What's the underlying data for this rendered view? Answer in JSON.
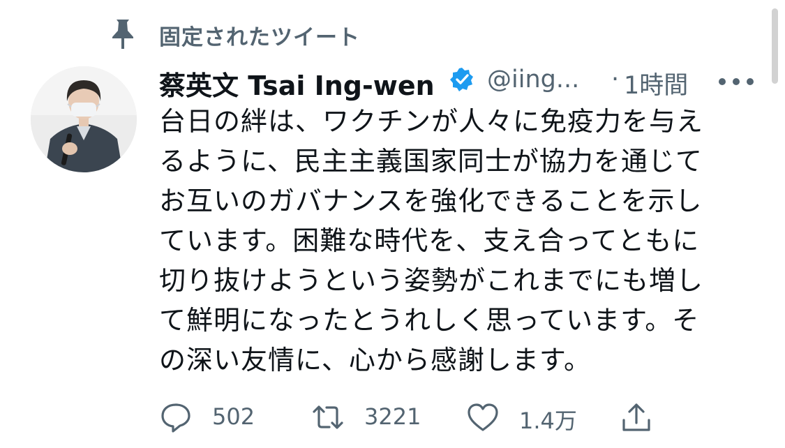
{
  "pinned": {
    "label": "固定されたツイート",
    "icon": "pin-icon"
  },
  "tweet": {
    "display_name": "蔡英文 Tsai Ing-wen",
    "handle": "@iing...",
    "separator": "·",
    "time": "1時間",
    "verified_icon": "verified-badge-icon",
    "avatar_icon": "avatar-photo",
    "text_lines": [
      "台日の絆は、ワクチンが人々に免疫力を与え",
      "るように、民主主義国家同士が協力を通じて",
      "お互いのガバナンスを強化できることを示し",
      "ています。困難な時代を、支え合ってともに",
      "切り抜けようという姿勢がこれまでにも増し",
      "て鮮明になったとうれしく思っています。そ",
      "の深い友情に、心から感謝します。"
    ]
  },
  "actions": {
    "reply": {
      "icon": "reply-icon",
      "count": "502"
    },
    "retweet": {
      "icon": "retweet-icon",
      "count": "3221"
    },
    "like": {
      "icon": "heart-icon",
      "count": "1.4万"
    },
    "share": {
      "icon": "share-icon"
    }
  },
  "colors": {
    "text": "#0f1419",
    "secondary": "#536471",
    "verified": "#1d9bf0"
  }
}
